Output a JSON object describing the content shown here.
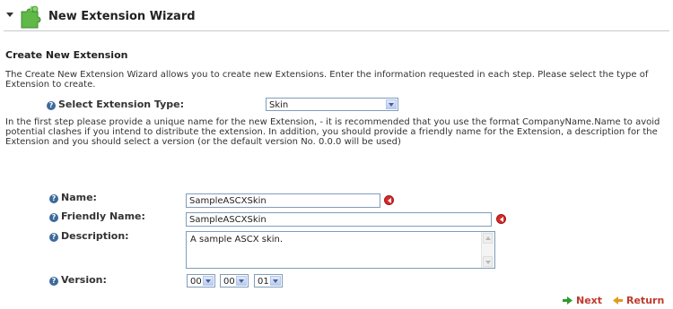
{
  "header": {
    "title": "New Extension Wizard",
    "collapse_icon": "collapse-arrow-icon",
    "module_icon": "puzzle-piece-icon"
  },
  "section": {
    "heading": "Create New Extension",
    "intro": "The Create New Extension Wizard allows you to create new Extensions. Enter the information requested in each step. Please select the type of Extension to create."
  },
  "extension_type": {
    "label": "Select Extension Type:",
    "selected": "Skin"
  },
  "description_text": "In the first step please provide a unique name for the new Extension, - it is recommended that you use the format CompanyName.Name to avoid potential clashes if you intend to distribute the extension. In addition, you should provide a friendly name for the Extension, a description for the Extension and you should select a version (or the default version No. 0.0.0 will be used)",
  "form": {
    "name_label": "Name:",
    "name_value": "SampleASCXSkin",
    "friendly_name_label": "Friendly Name:",
    "friendly_name_value": "SampleASCXSkin",
    "description_label": "Description:",
    "description_value": "A sample ASCX skin.",
    "version_label": "Version:",
    "version_major": "00",
    "version_minor": "00",
    "version_build": "01"
  },
  "actions": {
    "next_label": "Next",
    "return_label": "Return"
  },
  "colors": {
    "link": "#c0392b",
    "help_icon": "#3b6a9b",
    "required_icon": "#d42a2a",
    "input_border": "#7f9db9"
  }
}
